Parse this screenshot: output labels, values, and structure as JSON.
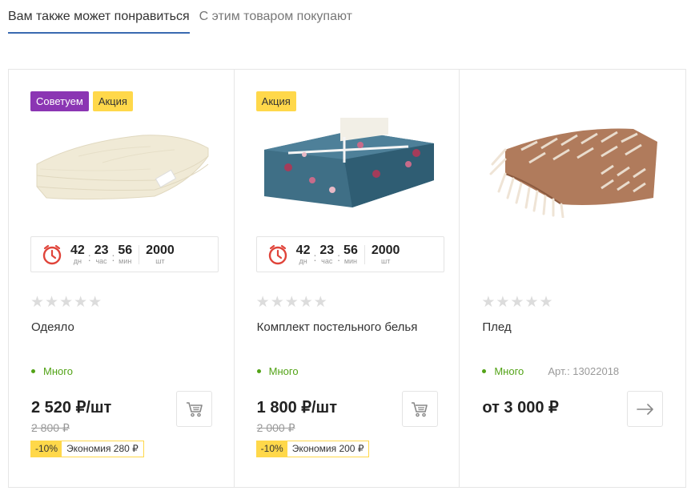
{
  "tabs": [
    {
      "label": "Вам также может понравиться",
      "active": true
    },
    {
      "label": "С этим товаром покупают",
      "active": false
    }
  ],
  "products": [
    {
      "badges": [
        "Советуем",
        "Акция"
      ],
      "timer": {
        "days": "42",
        "days_label": "дн",
        "hours": "23",
        "hours_label": "час",
        "minutes": "56",
        "minutes_label": "мин",
        "qty": "2000",
        "qty_label": "шт"
      },
      "stars": "★★★★★",
      "name": "Одеяло",
      "stock": "Много",
      "price": "2 520 ₽/шт",
      "old_price": "2 800 ₽",
      "discount": "-10%",
      "savings": "Экономия 280 ₽",
      "action_icon": "cart-icon"
    },
    {
      "badges": [
        "Акция"
      ],
      "timer": {
        "days": "42",
        "days_label": "дн",
        "hours": "23",
        "hours_label": "час",
        "minutes": "56",
        "minutes_label": "мин",
        "qty": "2000",
        "qty_label": "шт"
      },
      "stars": "★★★★★",
      "name": "Комплект постельного белья",
      "stock": "Много",
      "price": "1 800 ₽/шт",
      "old_price": "2 000 ₽",
      "discount": "-10%",
      "savings": "Экономия 200 ₽",
      "action_icon": "cart-icon"
    },
    {
      "badges": [],
      "stars": "★★★★★",
      "name": "Плед",
      "stock": "Много",
      "article": "Арт.: 13022018",
      "price": "от 3 000 ₽",
      "action_icon": "arrow-right-icon"
    }
  ],
  "colors": {
    "accent": "#3a6ab0",
    "badge_recommend": "#8b35b3",
    "badge_sale": "#ffd84a",
    "in_stock": "#53a317",
    "timer_clock": "#e0443a"
  }
}
